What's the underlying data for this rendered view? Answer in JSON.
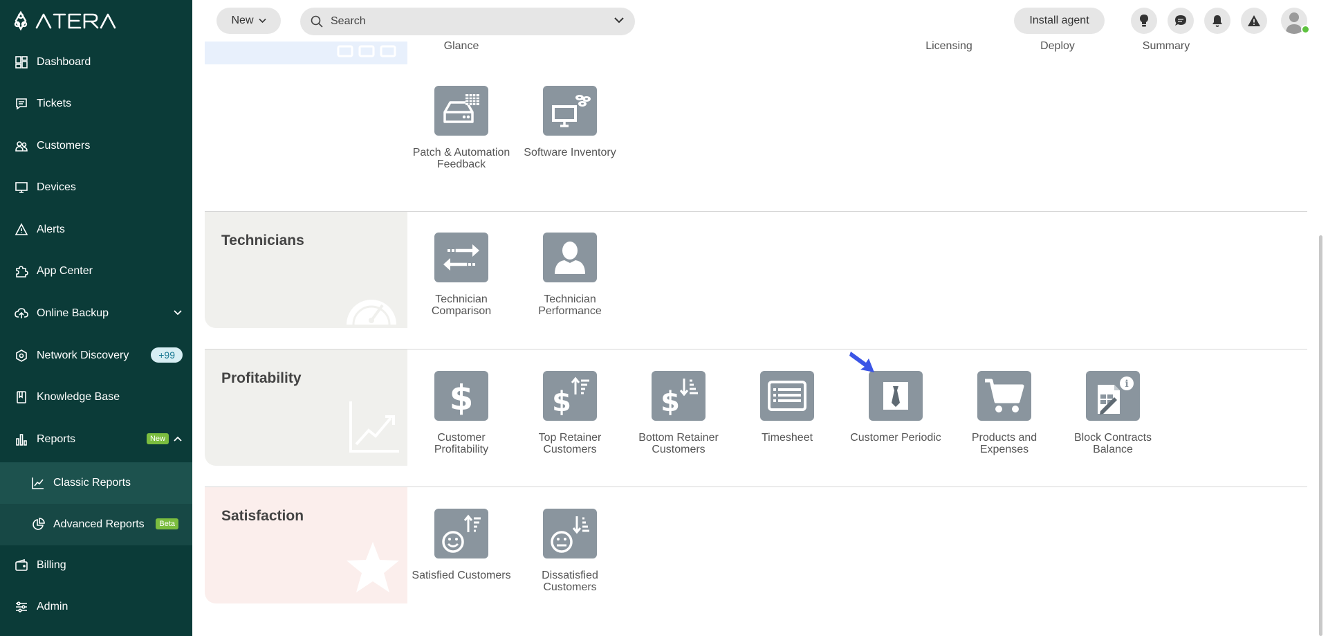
{
  "sidebar": {
    "logo_text": "ATERA",
    "items": [
      {
        "label": "Dashboard"
      },
      {
        "label": "Tickets"
      },
      {
        "label": "Customers"
      },
      {
        "label": "Devices"
      },
      {
        "label": "Alerts"
      },
      {
        "label": "App Center"
      },
      {
        "label": "Online Backup"
      },
      {
        "label": "Network Discovery",
        "badge": "+99"
      },
      {
        "label": "Knowledge Base"
      },
      {
        "label": "Reports",
        "badge": "New"
      },
      {
        "label": "Classic Reports"
      },
      {
        "label": "Advanced Reports",
        "badge": "Beta"
      },
      {
        "label": "Billing"
      },
      {
        "label": "Admin"
      }
    ]
  },
  "topbar": {
    "new_label": "New",
    "search_placeholder": "Search",
    "install_label": "Install agent"
  },
  "top_labels": [
    "Glance",
    "Licensing",
    "Deploy",
    "Summary"
  ],
  "sections": {
    "devices_tiles": [
      {
        "label": "Patch & Automation Feedback",
        "icon": "hard-drive-table-icon"
      },
      {
        "label": "Software Inventory",
        "icon": "monitor-software-icon"
      }
    ],
    "technicians": {
      "title": "Technicians",
      "tiles": [
        {
          "label": "Technician Comparison",
          "icon": "arrows-swap-icon"
        },
        {
          "label": "Technician Performance",
          "icon": "person-icon"
        }
      ]
    },
    "profitability": {
      "title": "Profitability",
      "tiles": [
        {
          "label": "Customer Profitability",
          "icon": "dollar-icon"
        },
        {
          "label": "Top Retainer Customers",
          "icon": "dollar-sort-up-icon"
        },
        {
          "label": "Bottom Retainer Customers",
          "icon": "dollar-sort-down-icon"
        },
        {
          "label": "Timesheet",
          "icon": "timesheet-icon"
        },
        {
          "label": "Customer Periodic",
          "icon": "tie-icon"
        },
        {
          "label": "Products and Expenses",
          "icon": "cart-icon"
        },
        {
          "label": "Block Contracts Balance",
          "icon": "contract-info-icon"
        }
      ]
    },
    "satisfaction": {
      "title": "Satisfaction",
      "tiles": [
        {
          "label": "Satisfied Customers",
          "icon": "smile-sort-up-icon"
        },
        {
          "label": "Dissatisfied Customers",
          "icon": "neutral-sort-down-icon"
        }
      ]
    }
  },
  "colors": {
    "sidebar_bg": "#0b3b38",
    "tile_bg": "#8a959e",
    "accent_green": "#7bbd3f",
    "pointer_blue": "#3b55e6"
  }
}
